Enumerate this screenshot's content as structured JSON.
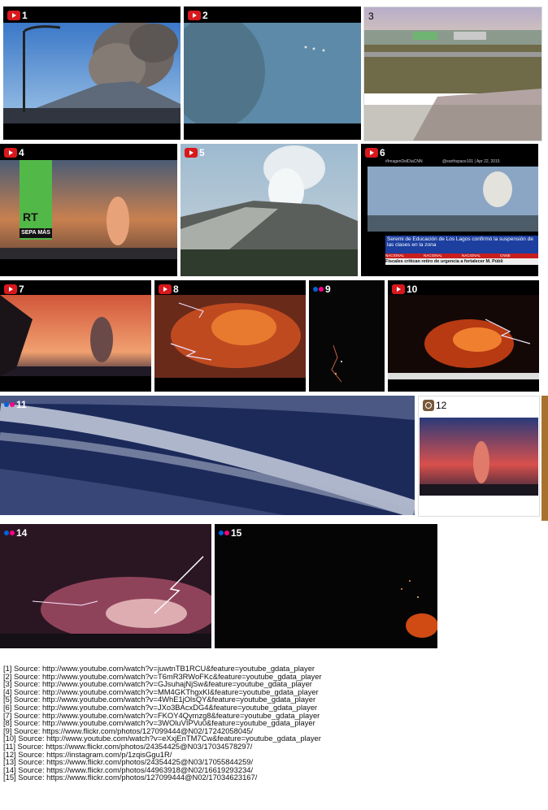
{
  "tiles": [
    {
      "num": "1",
      "platform": "youtube"
    },
    {
      "num": "2",
      "platform": "youtube"
    },
    {
      "num": "3",
      "platform": "none"
    },
    {
      "num": "4",
      "platform": "youtube",
      "overlay": "RT",
      "overlay_sub": "SEPA MÁS"
    },
    {
      "num": "5",
      "platform": "youtube"
    },
    {
      "num": "6",
      "platform": "youtube",
      "tv_tag": "#ImagenDelDíaCNN",
      "tv_handle": "@earthspace101 | Apr 22, 2015",
      "tv_headline": "Seremi de Educación de Los Lagos confirmó la suspensión de las clases en la zona",
      "tv_ticker": "Fiscales critican retiro de urgencia a fortalecer M. Públi",
      "tv_tab1": "NACIONAL",
      "tv_tab2": "NACIONAL",
      "tv_tab3": "NACIONAL",
      "tv_tab4": "CNNE"
    },
    {
      "num": "7",
      "platform": "youtube"
    },
    {
      "num": "8",
      "platform": "youtube"
    },
    {
      "num": "9",
      "platform": "flickr"
    },
    {
      "num": "10",
      "platform": "youtube"
    },
    {
      "num": "11",
      "platform": "flickr"
    },
    {
      "num": "12",
      "platform": "instagram"
    },
    {
      "num": "14",
      "platform": "flickr"
    },
    {
      "num": "15",
      "platform": "flickr"
    }
  ],
  "sources": [
    "[1] Source: http://www.youtube.com/watch?v=juwtnTB1RCU&feature=youtube_gdata_player",
    "[2] Source: http://www.youtube.com/watch?v=T6mR3RWoFKc&feature=youtube_gdata_player",
    "[3] Source: http://www.youtube.com/watch?v=GJsuhajNjSw&feature=youtube_gdata_player",
    "[4] Source: http://www.youtube.com/watch?v=MM4GKThgxKI&feature=youtube_gdata_player",
    "[5] Source: http://www.youtube.com/watch?v=4WhE1jOlsQY&feature=youtube_gdata_player",
    "[6] Source: http://www.youtube.com/watch?v=JXo3BAcxDG4&feature=youtube_gdata_player",
    "[7] Source: http://www.youtube.com/watch?v=FKOY4Qymzg8&feature=youtube_gdata_player",
    "[8] Source: http://www.youtube.com/watch?v=3WOluVIPVu0&feature=youtube_gdata_player",
    "[9] Source: https://www.flickr.com/photos/127099444@N02/17242058045/",
    "[10] Source: http://www.youtube.com/watch?v=eXxjEnTM7Cw&feature=youtube_gdata_player",
    "[11] Source: https://www.flickr.com/photos/24354425@N03/17034578297/",
    "[12] Source: https://instagram.com/p/1zqisGgu1R/",
    "[13] Source: https://www.flickr.com/photos/24354425@N03/17055844259/",
    "[14] Source: https://www.flickr.com/photos/44963918@N02/16619293234/",
    "[15] Source: https://www.flickr.com/photos/127099444@N02/17034623167/"
  ],
  "colors": {
    "youtube": "#d8181c",
    "flickr_blue": "#0063dc",
    "flickr_pink": "#ff0084"
  }
}
